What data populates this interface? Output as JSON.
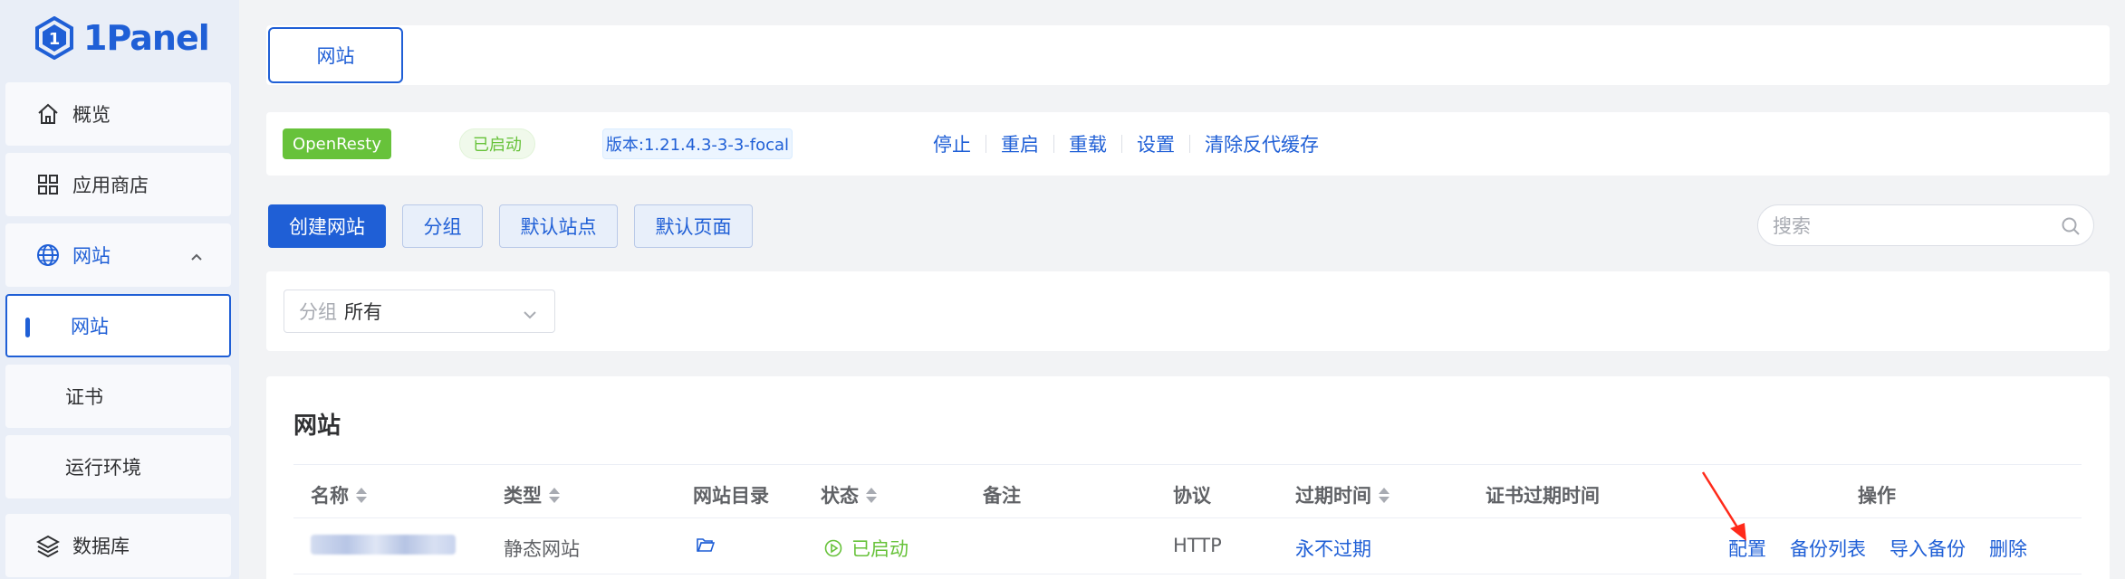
{
  "app": {
    "logo_text": "1Panel"
  },
  "sidebar": {
    "items": [
      {
        "label": "概览",
        "icon": "home-icon"
      },
      {
        "label": "应用商店",
        "icon": "grid-icon"
      },
      {
        "label": "网站",
        "icon": "globe-icon"
      },
      {
        "label": "网站"
      },
      {
        "label": "证书"
      },
      {
        "label": "运行环境"
      },
      {
        "label": "数据库",
        "icon": "layers-icon"
      }
    ]
  },
  "tabs": [
    {
      "label": "网站"
    }
  ],
  "service": {
    "name": "OpenResty",
    "status": "已启动",
    "version": "版本:1.21.4.3-3-3-focal",
    "actions": [
      "停止",
      "重启",
      "重载",
      "设置",
      "清除反代缓存"
    ]
  },
  "toolbar": {
    "create": "创建网站",
    "group": "分组",
    "default_site": "默认站点",
    "default_page": "默认页面"
  },
  "search": {
    "placeholder": "搜索"
  },
  "filter": {
    "label": "分组",
    "value": "所有"
  },
  "table": {
    "title": "网站",
    "columns": [
      "名称",
      "类型",
      "网站目录",
      "状态",
      "备注",
      "协议",
      "过期时间",
      "证书过期时间",
      "操作"
    ],
    "rows": [
      {
        "type": "静态网站",
        "status": "已启动",
        "protocol": "HTTP",
        "expire": "永不过期",
        "ops": [
          "配置",
          "备份列表",
          "导入备份",
          "删除"
        ]
      }
    ]
  },
  "colors": {
    "primary": "#1f5fd6",
    "success": "#67c23a",
    "annotation_arrow": "#ff2a1a"
  }
}
